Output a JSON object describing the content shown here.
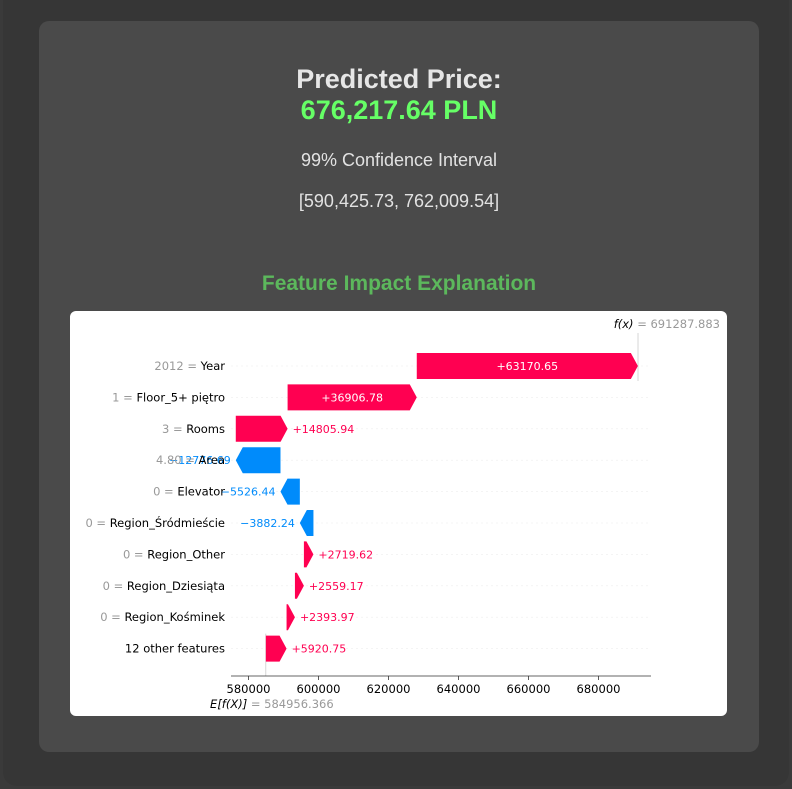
{
  "header": {
    "predicted_label": "Predicted Price:",
    "predicted_value": "676,217.64 PLN",
    "ci_label": "99% Confidence Interval",
    "ci_value": "[590,425.73, 762,009.54]",
    "explanation_title": "Feature Impact Explanation"
  },
  "colors": {
    "positive": "#ff0051",
    "negative": "#008bfb",
    "predicted": "#66ff66",
    "section_title": "#5cb85c"
  },
  "chart_data": {
    "type": "waterfall",
    "base_value": 584956.366,
    "base_label": "E[f(X)] = 584956.366",
    "output_value": 691287.883,
    "output_label": "f(x) = 691287.883",
    "xlim": [
      575000,
      695000
    ],
    "xticks": [
      580000,
      600000,
      620000,
      640000,
      660000,
      680000
    ],
    "features": [
      {
        "value": "2012",
        "name": "Year",
        "impact": 63170.65,
        "label": "+63170.65"
      },
      {
        "value": "1",
        "name": "Floor_5+ piętro",
        "impact": 36906.78,
        "label": "+36906.78"
      },
      {
        "value": "3",
        "name": "Rooms",
        "impact": 14805.94,
        "label": "+14805.94"
      },
      {
        "value": "4.80",
        "name": "Area",
        "impact": -12776.69,
        "label": "−12776.69"
      },
      {
        "value": "0",
        "name": "Elevator",
        "impact": -5526.44,
        "label": "−5526.44"
      },
      {
        "value": "0",
        "name": "Region_Śródmieście",
        "impact": -3882.24,
        "label": "−3882.24"
      },
      {
        "value": "0",
        "name": "Region_Other",
        "impact": 2719.62,
        "label": "+2719.62"
      },
      {
        "value": "0",
        "name": "Region_Dziesiąta",
        "impact": 2559.17,
        "label": "+2559.17"
      },
      {
        "value": "0",
        "name": "Region_Kośminek",
        "impact": 2393.97,
        "label": "+2393.97"
      },
      {
        "value": "",
        "name": "12 other features",
        "impact": 5920.75,
        "label": "+5920.75"
      }
    ]
  }
}
